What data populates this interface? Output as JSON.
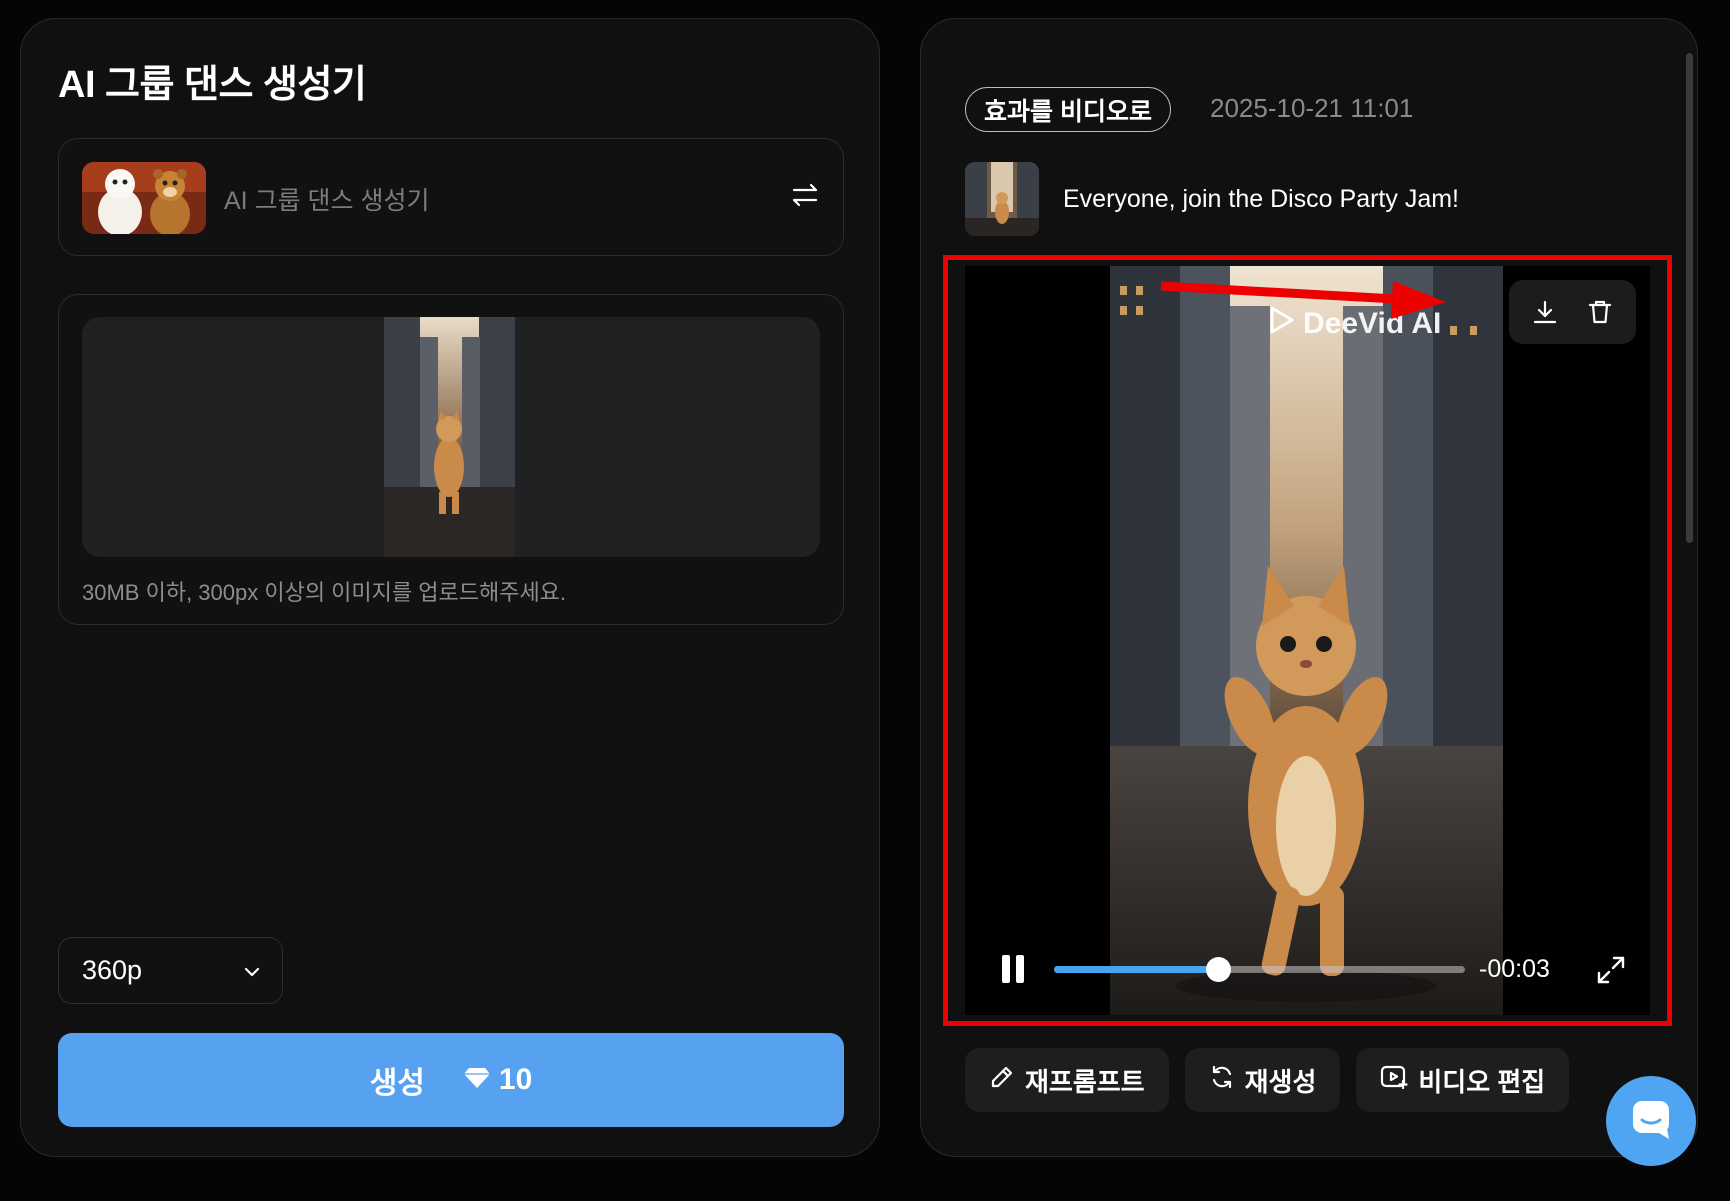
{
  "left_panel": {
    "title": "AI 그룹 댄스 생성기",
    "effect_selector": {
      "label": "AI 그룹 댄스 생성기",
      "swap_icon": "swap-arrows-icon"
    },
    "upload": {
      "hint": "30MB 이하, 300px 이상의 이미지를 업로드해주세요."
    },
    "resolution": {
      "value": "360p",
      "icon": "chevron-down-icon"
    },
    "generate": {
      "label": "생성",
      "cost": "10",
      "cost_icon": "diamond-icon"
    }
  },
  "right_panel": {
    "badge": "효과를 비디오로",
    "timestamp": "2025-10-21 11:01",
    "prompt": "Everyone, join the Disco Party Jam!",
    "video": {
      "watermark": "DeeVid AI",
      "download_icon": "download-icon",
      "delete_icon": "trash-icon",
      "pause_icon": "pause-icon",
      "time_remaining": "-00:03",
      "progress": 0.4,
      "fullscreen_icon": "fullscreen-icon"
    },
    "actions": [
      {
        "label": "재프롬프트",
        "icon": "pencil-icon"
      },
      {
        "label": "재생성",
        "icon": "refresh-icon"
      },
      {
        "label": "비디오 편집",
        "icon": "video-edit-icon"
      }
    ]
  },
  "chat_widget": {
    "icon": "chat-icon"
  },
  "colors": {
    "accent": "#57a2f0",
    "highlight": "#ec0000",
    "progress": "#4aa3ee"
  }
}
